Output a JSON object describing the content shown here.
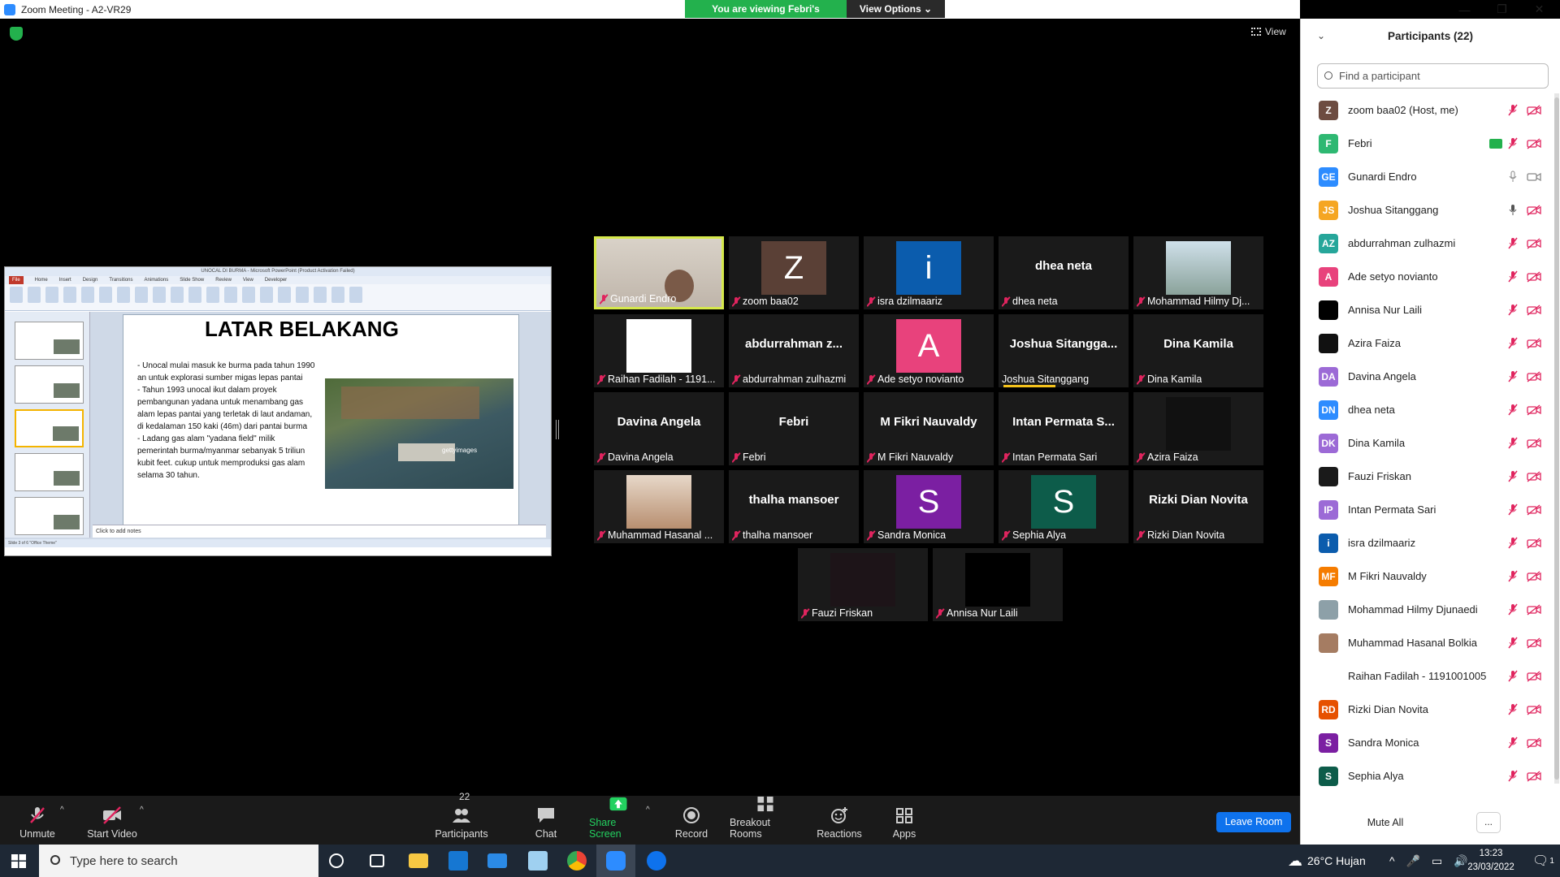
{
  "window": {
    "title": "Zoom Meeting - A2-VR29",
    "viewing_banner": "You are viewing Febri's screen",
    "view_options": "View Options",
    "view_label": "View"
  },
  "share": {
    "pp_title": "UNOCAL DI BURMA - Microsoft PowerPoint (Product Activation Failed)",
    "tabs": [
      "File",
      "Home",
      "Insert",
      "Design",
      "Transitions",
      "Animations",
      "Slide Show",
      "Review",
      "View",
      "Developer"
    ],
    "slide_title": "LATAR BELAKANG",
    "slide_text": "- Unocal mulai masuk ke burma pada tahun 1990 an untuk explorasi sumber migas lepas pantai\n- Tahun 1993 unocal ikut dalam proyek pembangunan yadana untuk menambang gas alam lepas pantai yang terletak di laut andaman, di kedalaman 150 kaki (46m) dari pantai burma\n- Ladang gas alam \"yadana field\" milik pemerintah burma/myanmar sebanyak 5 triliun kubit feet. cukup untuk memproduksi gas alam selama 30 tahun.",
    "photo_watermark": "gettyimages",
    "notes": "Click to add notes",
    "status": "Slide 3 of 6   \"Office Theme\""
  },
  "tiles": [
    {
      "name": "Gunardi Endro",
      "type": "video",
      "active": true
    },
    {
      "name": "zoom baa02",
      "type": "letter",
      "letter": "Z",
      "color": "#5a4036"
    },
    {
      "name": "isra dzilmaariz",
      "type": "letter",
      "letter": "i",
      "color": "#0b5cad"
    },
    {
      "name": "dhea neta",
      "type": "text"
    },
    {
      "name": "Mohammad Hilmy Dj...",
      "type": "photo"
    },
    {
      "name": "Raihan Fadilah - 1191...",
      "type": "white"
    },
    {
      "name": "abdurrahman zulhazmi",
      "big": "abdurrahman z...",
      "type": "text"
    },
    {
      "name": "Ade setyo novianto",
      "type": "letter",
      "letter": "A",
      "color": "#e8427c"
    },
    {
      "name": "Joshua Sitanggang",
      "big": "Joshua Sitangga...",
      "type": "text",
      "speaking": true
    },
    {
      "name": "Dina Kamila",
      "type": "text"
    },
    {
      "name": "Davina Angela",
      "type": "text"
    },
    {
      "name": "Febri",
      "type": "text"
    },
    {
      "name": "M Fikri Nauvaldy",
      "type": "text"
    },
    {
      "name": "Intan Permata Sari",
      "big": "Intan Permata S...",
      "type": "text"
    },
    {
      "name": "Azira Faiza",
      "type": "dark"
    },
    {
      "name": "Muhammad Hasanal ...",
      "type": "photo2"
    },
    {
      "name": "thalha mansoer",
      "type": "text"
    },
    {
      "name": "Sandra Monica",
      "type": "letter",
      "letter": "S",
      "color": "#7b1fa2"
    },
    {
      "name": "Sephia Alya",
      "type": "letter",
      "letter": "S",
      "color": "#0d5c4a"
    },
    {
      "name": "Rizki Dian Novita",
      "type": "text"
    },
    {
      "name": "Fauzi Friskan",
      "type": "dark2"
    },
    {
      "name": "Annisa Nur Laili",
      "type": "black"
    }
  ],
  "toolbar": {
    "unmute": "Unmute",
    "start_video": "Start Video",
    "participants": "Participants",
    "participants_count": "22",
    "chat": "Chat",
    "share_screen": "Share Screen",
    "record": "Record",
    "breakout": "Breakout Rooms",
    "reactions": "Reactions",
    "apps": "Apps",
    "leave": "Leave Room"
  },
  "panel": {
    "title": "Participants (22)",
    "search_placeholder": "Find a participant",
    "mute_all": "Mute All",
    "more": "...",
    "participants": [
      {
        "initials": "Z",
        "name": "zoom baa02 (Host, me)",
        "color": "#6d4c41",
        "mic": "off",
        "cam": "off"
      },
      {
        "initials": "F",
        "name": "Febri",
        "color": "#2eb872",
        "mic": "off",
        "cam": "off",
        "sharing": true
      },
      {
        "initials": "GE",
        "name": "Gunardi Endro",
        "color": "#2d8cff",
        "mic": "on",
        "cam": "on"
      },
      {
        "initials": "JS",
        "name": "Joshua Sitanggang",
        "color": "#f5a623",
        "mic": "on-dark",
        "cam": "off"
      },
      {
        "initials": "AZ",
        "name": "abdurrahman zulhazmi",
        "color": "#26a69a",
        "mic": "off",
        "cam": "off"
      },
      {
        "initials": "A",
        "name": "Ade setyo novianto",
        "color": "#e8427c",
        "mic": "off",
        "cam": "off"
      },
      {
        "initials": "",
        "name": "Annisa Nur Laili",
        "color": "#000000",
        "mic": "off",
        "cam": "off"
      },
      {
        "initials": "",
        "name": "Azira Faiza",
        "color": "#111111",
        "mic": "off",
        "cam": "off"
      },
      {
        "initials": "DA",
        "name": "Davina Angela",
        "color": "#9c6ad6",
        "mic": "off",
        "cam": "off"
      },
      {
        "initials": "DN",
        "name": "dhea neta",
        "color": "#2d8cff",
        "mic": "off",
        "cam": "off"
      },
      {
        "initials": "DK",
        "name": "Dina Kamila",
        "color": "#9c6ad6",
        "mic": "off",
        "cam": "off"
      },
      {
        "initials": "",
        "name": "Fauzi Friskan",
        "color": "#1a1a1a",
        "mic": "off",
        "cam": "off"
      },
      {
        "initials": "IP",
        "name": "Intan Permata Sari",
        "color": "#9c6ad6",
        "mic": "off",
        "cam": "off"
      },
      {
        "initials": "i",
        "name": "isra dzilmaariz",
        "color": "#0b5cad",
        "mic": "off",
        "cam": "off"
      },
      {
        "initials": "MF",
        "name": "M Fikri Nauvaldy",
        "color": "#f57c00",
        "mic": "off",
        "cam": "off"
      },
      {
        "initials": "",
        "name": "Mohammad Hilmy Djunaedi",
        "color": "#8da0a8",
        "mic": "off",
        "cam": "off"
      },
      {
        "initials": "",
        "name": "Muhammad Hasanal Bolkia",
        "color": "#a57c62",
        "mic": "off",
        "cam": "off"
      },
      {
        "initials": "",
        "name": "Raihan Fadilah - 1191001005",
        "color": "#ffffff",
        "mic": "off",
        "cam": "off"
      },
      {
        "initials": "RD",
        "name": "Rizki Dian Novita",
        "color": "#e65100",
        "mic": "off",
        "cam": "off"
      },
      {
        "initials": "S",
        "name": "Sandra Monica",
        "color": "#7b1fa2",
        "mic": "off",
        "cam": "off"
      },
      {
        "initials": "S",
        "name": "Sephia Alya",
        "color": "#0d5c4a",
        "mic": "off",
        "cam": "off"
      }
    ]
  },
  "taskbar": {
    "search_placeholder": "Type here to search",
    "weather": "26°C  Hujan",
    "time": "13:23",
    "date": "23/03/2022",
    "notif_count": "1"
  },
  "colors": {
    "accent": "#2d8cff",
    "green": "#23b14d",
    "mic_off": "#e0245e",
    "active_speaker": "#d6e94b"
  }
}
